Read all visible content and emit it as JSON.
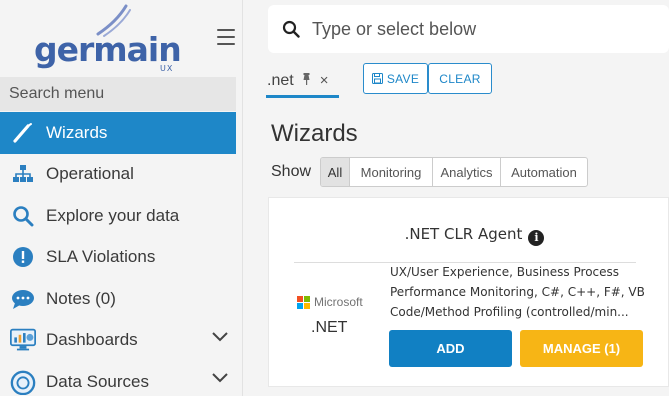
{
  "brand": {
    "name": "germain",
    "suffix": "UX",
    "color": "#3e63a8"
  },
  "sidebar": {
    "search_placeholder": "Search menu",
    "items": [
      {
        "label": "Wizards",
        "icon": "wand-icon",
        "active": true
      },
      {
        "label": "Operational",
        "icon": "sitemap-icon"
      },
      {
        "label": "Explore your data",
        "icon": "search-icon"
      },
      {
        "label": "SLA Violations",
        "icon": "alert-circle-icon"
      },
      {
        "label": "Notes (0)",
        "icon": "comment-icon"
      },
      {
        "label": "Dashboards",
        "icon": "dashboard-monitor-icon",
        "expandable": true
      },
      {
        "label": "Data Sources",
        "icon": "database-icon",
        "expandable": true
      }
    ],
    "active_color": "#1e87c8"
  },
  "header": {
    "search_placeholder": "Type or select below"
  },
  "tabs": [
    {
      "label": ".net",
      "pinned": true,
      "closable": true
    }
  ],
  "toolbar": {
    "save_label": "SAVE",
    "clear_label": "CLEAR"
  },
  "page": {
    "title": "Wizards",
    "show_label": "Show",
    "filters": [
      "All",
      "Monitoring",
      "Analytics",
      "Automation"
    ],
    "selected_filter": "All"
  },
  "card": {
    "title": ".NET CLR Agent",
    "vendor": "Microsoft",
    "product": ".NET",
    "description_lines": [
      "UX/User Experience, Business Process",
      "Performance Monitoring, C#, C++, F#, VB",
      "Code/Method Profiling (controlled/min..."
    ],
    "add_label": "ADD",
    "manage_label": "MANAGE (1)",
    "add_color": "#1180c3",
    "manage_color": "#f7b515"
  }
}
